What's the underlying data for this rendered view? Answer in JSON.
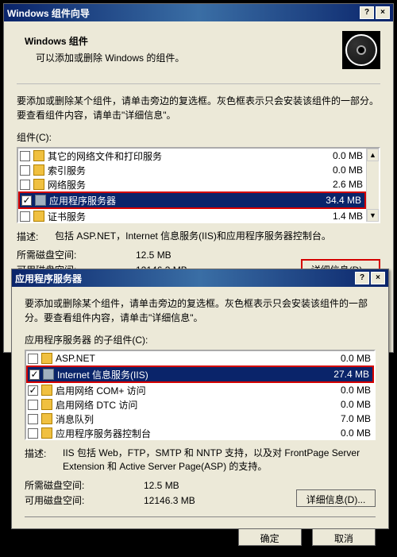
{
  "colors": {
    "highlight": "#d40000",
    "selection": "#0a246a"
  },
  "win1": {
    "title": "Windows 组件向导",
    "header_title": "Windows 组件",
    "header_sub": "可以添加或删除 Windows 的组件。",
    "instr": "要添加或删除某个组件，请单击旁边的复选框。灰色框表示只会安装该组件的一部分。要查看组件内容，请单击\"详细信息\"。",
    "components_label": "组件(C):",
    "components": [
      {
        "checked": false,
        "icon": "folder",
        "name": "其它的网络文件和打印服务",
        "size": "0.0 MB"
      },
      {
        "checked": false,
        "icon": "folder",
        "name": "索引服务",
        "size": "0.0 MB"
      },
      {
        "checked": false,
        "icon": "folder",
        "name": "网络服务",
        "size": "2.6 MB"
      },
      {
        "checked": true,
        "icon": "server",
        "name": "应用程序服务器",
        "size": "34.4 MB",
        "selected": true,
        "highlighted": true
      },
      {
        "checked": false,
        "icon": "folder",
        "name": "证书服务",
        "size": "1.4 MB"
      }
    ],
    "desc_label": "描述:",
    "desc": "包括 ASP.NET，Internet 信息服务(IIS)和应用程序服务器控制台。",
    "space_req_label": "所需磁盘空间:",
    "space_req": "12.5 MB",
    "space_free_label": "可用磁盘空间:",
    "space_free": "12146.3 MB",
    "details_btn": "详细信息(D)...",
    "details_highlighted": true
  },
  "win2": {
    "title": "应用程序服务器",
    "instr": "要添加或删除某个组件，请单击旁边的复选框。灰色框表示只会安装该组件的一部分。要查看组件内容，请单击\"详细信息\"。",
    "components_label": "应用程序服务器 的子组件(C):",
    "components": [
      {
        "checked": false,
        "icon": "folder",
        "name": "ASP.NET",
        "size": "0.0 MB"
      },
      {
        "checked": true,
        "icon": "server",
        "name": "Internet 信息服务(IIS)",
        "size": "27.4 MB",
        "selected": true,
        "highlighted": true
      },
      {
        "checked": true,
        "icon": "folder",
        "name": "启用网络 COM+ 访问",
        "size": "0.0 MB"
      },
      {
        "checked": false,
        "icon": "folder",
        "name": "启用网络 DTC 访问",
        "size": "0.0 MB"
      },
      {
        "checked": false,
        "icon": "folder",
        "name": "消息队列",
        "size": "7.0 MB"
      },
      {
        "checked": false,
        "icon": "folder",
        "name": "应用程序服务器控制台",
        "size": "0.0 MB"
      }
    ],
    "desc_label": "描述:",
    "desc": "IIS 包括 Web，FTP，SMTP 和 NNTP 支持，以及对 FrontPage Server Extension 和 Active Server Page(ASP) 的支持。",
    "space_req_label": "所需磁盘空间:",
    "space_req": "12.5 MB",
    "space_free_label": "可用磁盘空间:",
    "space_free": "12146.3 MB",
    "details_btn": "详细信息(D)...",
    "ok_btn": "确定",
    "cancel_btn": "取消"
  }
}
